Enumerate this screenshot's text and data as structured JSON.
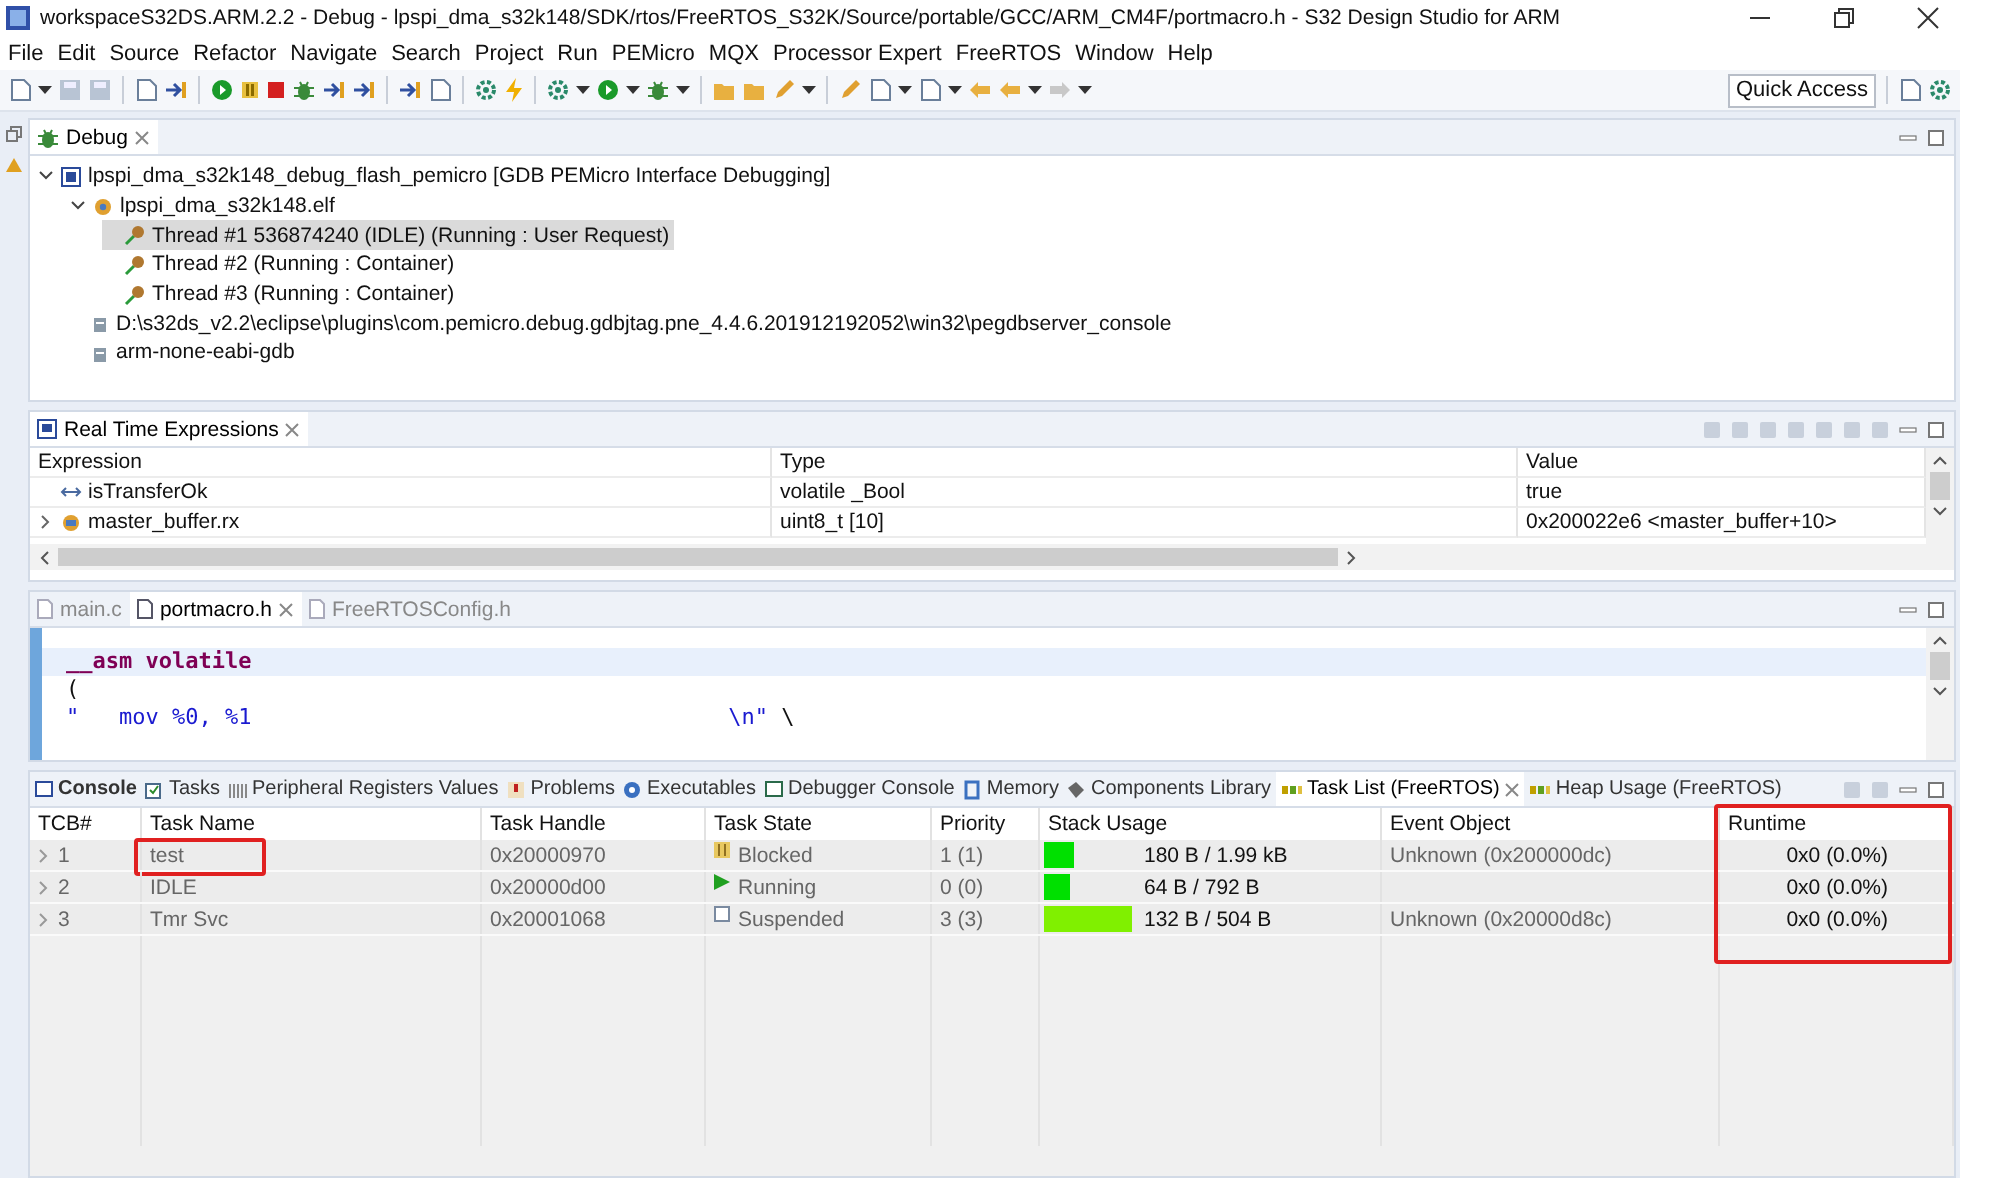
{
  "window": {
    "title": "workspaceS32DS.ARM.2.2 - Debug - lpspi_dma_s32k148/SDK/rtos/FreeRTOS_S32K/Source/portable/GCC/ARM_CM4F/portmacro.h - S32 Design Studio for ARM"
  },
  "menu": [
    "File",
    "Edit",
    "Source",
    "Refactor",
    "Navigate",
    "Search",
    "Project",
    "Run",
    "PEMicro",
    "MQX",
    "Processor Expert",
    "FreeRTOS",
    "Window",
    "Help"
  ],
  "toolbar": {
    "quick_access": "Quick Access"
  },
  "debug_view": {
    "tab": "Debug",
    "tree": [
      {
        "label": "lpspi_dma_s32k148_debug_flash_pemicro [GDB PEMicro Interface Debugging]",
        "kind": "launch",
        "selected": false,
        "expanded": true,
        "children": [
          {
            "label": "lpspi_dma_s32k148.elf",
            "kind": "process",
            "selected": false,
            "expanded": true,
            "children": [
              {
                "label": "Thread #1 536874240 (IDLE) (Running : User Request)",
                "kind": "thread",
                "selected": true
              },
              {
                "label": "Thread #2 (Running : Container)",
                "kind": "thread",
                "selected": false
              },
              {
                "label": "Thread #3 (Running : Container)",
                "kind": "thread",
                "selected": false
              }
            ]
          },
          {
            "label": "D:\\s32ds_v2.2\\eclipse\\plugins\\com.pemicro.debug.gdbjtag.pne_4.4.6.201912192052\\win32\\pegdbserver_console",
            "kind": "server",
            "selected": false
          },
          {
            "label": "arm-none-eabi-gdb",
            "kind": "server",
            "selected": false
          }
        ]
      }
    ]
  },
  "expressions": {
    "tab": "Real Time Expressions",
    "columns": [
      "Expression",
      "Type",
      "Value"
    ],
    "rows": [
      {
        "expression": "isTransferOk",
        "type": "volatile _Bool",
        "value": "true",
        "kind": "scalar",
        "expandable": false
      },
      {
        "expression": "master_buffer.rx",
        "type": "uint8_t [10]",
        "value": "0x200022e6 <master_buffer+10>",
        "kind": "array",
        "expandable": true
      }
    ]
  },
  "editor": {
    "tabs": [
      {
        "label": "main.c",
        "selected": false
      },
      {
        "label": "portmacro.h",
        "selected": true
      },
      {
        "label": "FreeRTOSConfig.h",
        "selected": false
      }
    ],
    "lines": [
      {
        "current": true,
        "segments": [
          {
            "text": "__asm volatile",
            "kind": "keyword"
          }
        ]
      },
      {
        "current": false,
        "segments": [
          {
            "text": "(",
            "kind": "plain"
          }
        ]
      },
      {
        "current": false,
        "segments": [
          {
            "text": "\"   mov %0, %1                                    \\n\"",
            "kind": "string"
          },
          {
            "text": " \\",
            "kind": "plain"
          }
        ]
      }
    ]
  },
  "bottom_panel": {
    "tabs": [
      {
        "label": "Console",
        "selected": false,
        "bold": true
      },
      {
        "label": "Tasks",
        "selected": false,
        "bold": false
      },
      {
        "label": "Peripheral Registers Values",
        "selected": false,
        "bold": false
      },
      {
        "label": "Problems",
        "selected": false,
        "bold": false
      },
      {
        "label": "Executables",
        "selected": false,
        "bold": false
      },
      {
        "label": "Debugger Console",
        "selected": false,
        "bold": false
      },
      {
        "label": "Memory",
        "selected": false,
        "bold": false
      },
      {
        "label": "Components Library",
        "selected": false,
        "bold": false
      },
      {
        "label": "Task List (FreeRTOS)",
        "selected": true,
        "bold": false
      },
      {
        "label": "Heap Usage (FreeRTOS)",
        "selected": false,
        "bold": false
      }
    ],
    "columns": [
      {
        "label": "TCB#",
        "highlighted": false
      },
      {
        "label": "Task Name",
        "highlighted": false
      },
      {
        "label": "Task Handle",
        "highlighted": false
      },
      {
        "label": "Task State",
        "highlighted": false
      },
      {
        "label": "Priority",
        "highlighted": false
      },
      {
        "label": "Stack Usage",
        "highlighted": false
      },
      {
        "label": "Event Object",
        "highlighted": false
      },
      {
        "label": "Runtime",
        "highlighted": true
      }
    ],
    "rows": [
      {
        "tcb": "1",
        "name": "test",
        "name_highlighted": true,
        "handle": "0x20000970",
        "state": {
          "label": "Blocked",
          "kind": "blocked"
        },
        "priority": "1 (1)",
        "stack": {
          "level": 0.09,
          "reading": "180 B / 1.99 kB",
          "color": "#00e000"
        },
        "event": "Unknown (0x200000dc)",
        "runtime": "0x0 (0.0%)"
      },
      {
        "tcb": "2",
        "name": "IDLE",
        "name_highlighted": false,
        "handle": "0x20000d00",
        "state": {
          "label": "Running",
          "kind": "running"
        },
        "priority": "0 (0)",
        "stack": {
          "level": 0.08,
          "reading": "64 B / 792 B",
          "color": "#00e000"
        },
        "runtime": "0x0 (0.0%)"
      },
      {
        "tcb": "3",
        "name": "Tmr Svc",
        "name_highlighted": false,
        "handle": "0x20001068",
        "state": {
          "label": "Suspended",
          "kind": "suspended"
        },
        "priority": "3 (3)",
        "stack": {
          "level": 0.26,
          "reading": "132 B / 504 B",
          "color": "#80f000"
        },
        "event": "Unknown (0x20000d8c)",
        "runtime": "0x0 (0.0%)"
      }
    ]
  }
}
